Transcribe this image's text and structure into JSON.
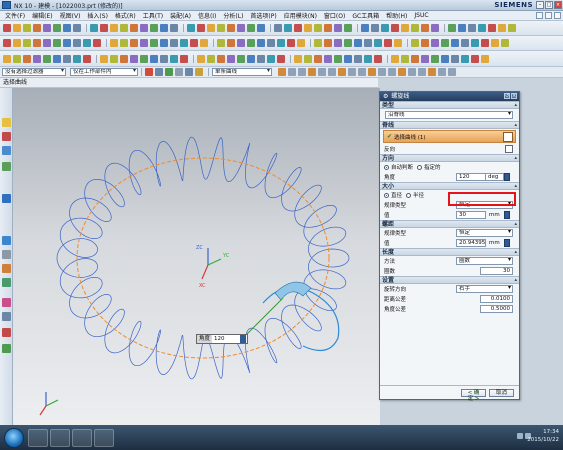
{
  "window": {
    "title": "NX 10 - 建模 - [1022003.prt  (修改的)]",
    "brand": "SIEMENS"
  },
  "menu": [
    "文件(F)",
    "编辑(E)",
    "视图(V)",
    "插入(S)",
    "格式(R)",
    "工具(T)",
    "装配(A)",
    "信息(I)",
    "分析(L)",
    "首选项(P)",
    "应用模块(N)",
    "窗口(O)",
    "GC工具箱",
    "帮助(H)",
    "JSUC"
  ],
  "filter_bar": {
    "selection_filter": "没有选择过滤器",
    "scope": "仅在工作部件内",
    "curve_rule": "单条曲线"
  },
  "cue_line": "选择曲线",
  "viewport": {
    "triad_labels": [
      "ZC",
      "YC",
      "XC"
    ],
    "angle_tip": {
      "label": "角度",
      "value": "120"
    }
  },
  "dialog": {
    "title": "螺旋线",
    "sections": {
      "type": {
        "label": "类型",
        "value": "沿脊线"
      },
      "spine": {
        "label": "脊线",
        "select_curve": "选择曲线 (1)",
        "reverse": "反向"
      },
      "direction": {
        "label": "方向",
        "auto": "自动判断",
        "specified": "指定的",
        "angle_label": "角度",
        "angle_value": "120",
        "angle_unit": "deg"
      },
      "size": {
        "label": "大小",
        "diameter": "直径",
        "radius": "半径",
        "law_label": "规律类型",
        "law_value": "恒定",
        "value_label": "值",
        "value": "30",
        "unit": "mm"
      },
      "pitch": {
        "label": "螺距",
        "law_label": "规律类型",
        "law_value": "恒定",
        "value_label": "值",
        "value": "20.943951",
        "unit": "mm"
      },
      "length": {
        "label": "长度",
        "method_label": "方法",
        "method_value": "圈数",
        "turns_label": "圈数",
        "turns_value": "30"
      },
      "settings": {
        "label": "设置",
        "rotation_label": "旋转方向",
        "rotation_value": "右手",
        "dist_tol_label": "距离公差",
        "dist_tol_value": "0.0100",
        "angle_tol_label": "角度公差",
        "angle_tol_value": "0.5000"
      }
    },
    "ok": "< 确定 >",
    "cancel": "取消"
  },
  "taskbar": {
    "time": "17:34",
    "date": "2015/10/22"
  },
  "colors": {
    "helix": "#3b63c8",
    "spine": "#f08a30",
    "highlight": "#e3121b"
  }
}
